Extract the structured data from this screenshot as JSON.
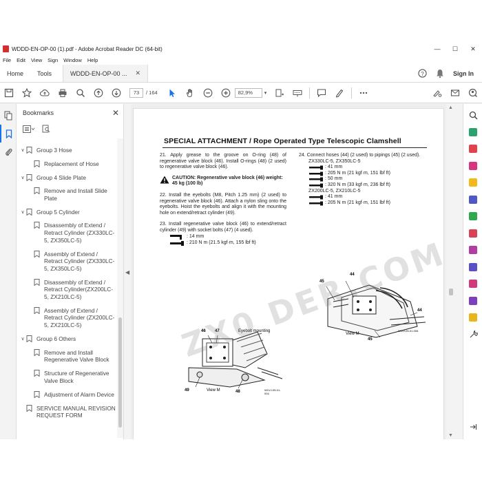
{
  "window": {
    "title": "WDDD-EN-OP-00 (1).pdf - Adobe Acrobat Reader DC (64-bit)"
  },
  "menu": [
    "File",
    "Edit",
    "View",
    "Sign",
    "Window",
    "Help"
  ],
  "tabs": {
    "home": "Home",
    "tools": "Tools",
    "document": "WDDD-EN-OP-00 ...",
    "sign_in": "Sign In"
  },
  "toolbar": {
    "page_current": "73",
    "page_total": "/ 164",
    "zoom": "82,9%"
  },
  "bookmarks": {
    "title": "Bookmarks",
    "items": [
      {
        "label": "Group 3 Hose",
        "level": 1,
        "expanded": true
      },
      {
        "label": "Replacement of Hose",
        "level": 2
      },
      {
        "label": "Group 4 Slide Plate",
        "level": 1,
        "expanded": true
      },
      {
        "label": "Remove and Install Slide Plate",
        "level": 2
      },
      {
        "label": "Group 5 Cylinder",
        "level": 1,
        "expanded": true
      },
      {
        "label": "Disassembly of Extend / Retract Cylinder (ZX330LC-5, ZX350LC-5)",
        "level": 2
      },
      {
        "label": "Assembly of Extend / Retract Cylinder (ZX330LC-5, ZX350LC-5)",
        "level": 2
      },
      {
        "label": "Disassembly of Extend / Retract Cylinder(ZX200LC-5, ZX210LC-5)",
        "level": 2
      },
      {
        "label": "Assembly of Extend / Retract Cylinder (ZX200LC-5, ZX210LC-5)",
        "level": 2
      },
      {
        "label": "Group 6 Others",
        "level": 1,
        "expanded": true
      },
      {
        "label": "Remove and Install Regenerative Valve Block",
        "level": 2
      },
      {
        "label": "Structure of Regenerative Valve Block",
        "level": 2
      },
      {
        "label": "Adjustment of Alarm Device",
        "level": 2
      },
      {
        "label": "SERVICE MANUAL REVISION REQUEST FORM",
        "level": 1
      }
    ]
  },
  "page": {
    "title": "SPECIAL ATTACHMENT / Rope Operated Type Telescopic Clamshell",
    "step21": "21. Apply grease to the groove on O-ring (48) of regenerative valve block (46). Install O-rings (48) (2 used) to regenerative valve block (46).",
    "caution": "CAUTION: Regenerative valve block (46) weight: 45 kg (100 lb)",
    "step22": "22. Install the eyebolts (M8, Pitch 1.25 mm) (2 used) to regenerative valve block (46). Attach a nylon sling onto the eyebolts. Hoist the eyebolts and align it with the mounting hole on extend/retract cylinder (49).",
    "step23": "23. Install regenerative valve block (46) to extend/retract cylinder (49) with socket bolts (47) (4 used).",
    "step23_tool": ": 14 mm",
    "step23_torque": ": 210 N m (21.5 kgf·m, 155 lbf ft)",
    "fig1_labels": {
      "a": "46",
      "b": "47",
      "eyebolt": "Eyebolt mounting",
      "c": "49",
      "view": "View M",
      "d": "48",
      "code": "W1VJ-05-01-004"
    },
    "step24": "24. Connect hoses (44) (2 used) to pipings (45) (2 used).",
    "model_a": "ZX330LC-5, ZX350LC-5",
    "model_a_specs": [
      ": 41 mm",
      ": 205 N m (21 kgf·m, 151 lbf ft)",
      ": 50 mm",
      ": 320 N m (33 kgf·m, 236 lbf ft)"
    ],
    "model_b": "ZX200LC-5, ZX210LC-5",
    "model_b_specs": [
      ": 41 mm",
      ": 205 N m (21 kgf·m, 151 lbf ft)"
    ],
    "fig2_labels": {
      "a": "44",
      "b": "45",
      "c": "44",
      "d": "45",
      "view": "View M",
      "code": "W1VI-05-01-006"
    },
    "watermark": "ZX0 DER.COM"
  }
}
